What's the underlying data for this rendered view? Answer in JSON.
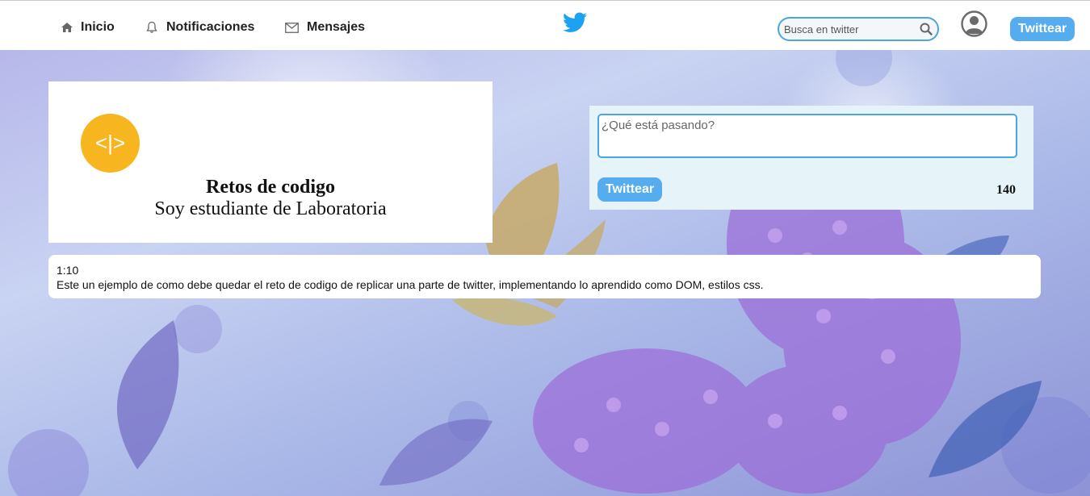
{
  "nav": {
    "home_label": "Inicio",
    "notifications_label": "Notificaciones",
    "messages_label": "Mensajes"
  },
  "search": {
    "placeholder": "Busca en twitter"
  },
  "header": {
    "tweet_button": "Twittear"
  },
  "profile": {
    "logo_text": "<|>",
    "name": "Retos de codigo",
    "bio": "Soy estudiante de Laboratoria"
  },
  "compose": {
    "placeholder": "¿Qué está pasando?",
    "button_label": "Twittear",
    "char_count": "140"
  },
  "tweets": [
    {
      "time": "1:10",
      "text": "Este un ejemplo de como debe quedar el reto de codigo de replicar una parte de twitter, implementando lo aprendido como DOM, estilos css."
    }
  ],
  "colors": {
    "accent": "#55acee",
    "logo_yellow": "#f7b51f",
    "compose_bg": "#e6f4f9"
  },
  "icons": [
    "home-icon",
    "bell-icon",
    "envelope-icon",
    "twitter-bird-icon",
    "search-icon",
    "user-avatar-icon"
  ]
}
